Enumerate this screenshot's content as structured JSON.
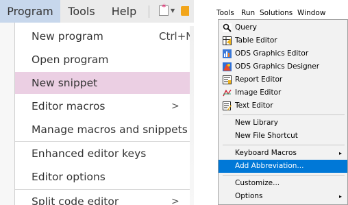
{
  "left_menu": {
    "menubar": {
      "items": [
        "Program",
        "Tools",
        "Help"
      ],
      "active": "Program"
    },
    "dropdown": {
      "items": [
        {
          "label": "New program",
          "shortcut": "Ctrl+N"
        },
        {
          "label": "Open program"
        },
        {
          "label": "New snippet",
          "highlighted": true
        },
        {
          "label": "Editor macros",
          "submenu": ">"
        },
        {
          "label": "Manage macros and snippets"
        },
        {
          "label": "Enhanced editor keys"
        },
        {
          "label": "Editor options"
        },
        {
          "label": "Split code editor",
          "submenu": ">"
        }
      ]
    }
  },
  "right_menu": {
    "menubar": [
      "Tools",
      "Run",
      "Solutions",
      "Window"
    ],
    "items": [
      {
        "label": "Query",
        "icon": "query-icon"
      },
      {
        "label": "Table Editor",
        "icon": "table-editor-icon"
      },
      {
        "label": "ODS Graphics Editor",
        "icon": "ods-graphics-editor-icon"
      },
      {
        "label": "ODS Graphics Designer",
        "icon": "ods-graphics-designer-icon"
      },
      {
        "label": "Report Editor",
        "icon": "report-editor-icon"
      },
      {
        "label": "Image Editor",
        "icon": "image-editor-icon"
      },
      {
        "label": "Text Editor",
        "icon": "text-editor-icon"
      },
      {
        "label": "New Library"
      },
      {
        "label": "New File Shortcut"
      },
      {
        "label": "Keyboard Macros",
        "submenu": "▸"
      },
      {
        "label": "Add Abbreviation...",
        "highlighted": true
      },
      {
        "label": "Customize..."
      },
      {
        "label": "Options",
        "submenu": "▸"
      }
    ]
  },
  "colors": {
    "left_highlight": "#ebcfe3",
    "left_menubar_active": "#c7d7ec",
    "right_highlight": "#0078d7"
  }
}
